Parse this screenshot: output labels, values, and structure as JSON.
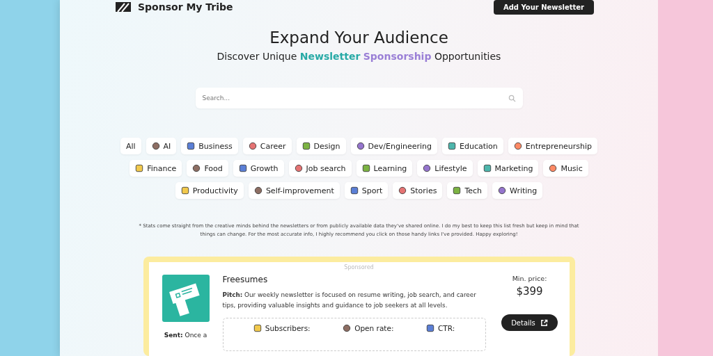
{
  "header": {
    "brand": "Sponsor My Tribe",
    "cta": "Add Your Newsletter"
  },
  "hero": {
    "title": "Expand Your Audience",
    "subtitle": "Discover Unique ",
    "highlight_1": "Newsletter",
    "highlight_2": "Sponsorship",
    "subtitle_end": " Opportunities"
  },
  "search": {
    "placeholder": "Search..."
  },
  "categories": [
    {
      "label": "All",
      "icon": false
    },
    {
      "label": "AI",
      "icon": true
    },
    {
      "label": "Business",
      "icon": true
    },
    {
      "label": "Career",
      "icon": true
    },
    {
      "label": "Design",
      "icon": true
    },
    {
      "label": "Dev/Engineering",
      "icon": true
    },
    {
      "label": "Education",
      "icon": true
    },
    {
      "label": "Entrepreneurship",
      "icon": true
    },
    {
      "label": "Finance",
      "icon": true
    },
    {
      "label": "Food",
      "icon": true
    },
    {
      "label": "Growth",
      "icon": true
    },
    {
      "label": "Job search",
      "icon": true
    },
    {
      "label": "Learning",
      "icon": true
    },
    {
      "label": "Lifestyle",
      "icon": true
    },
    {
      "label": "Marketing",
      "icon": true
    },
    {
      "label": "Music",
      "icon": true
    },
    {
      "label": "Productivity",
      "icon": true
    },
    {
      "label": "Self-improvement",
      "icon": true
    },
    {
      "label": "Sport",
      "icon": true
    },
    {
      "label": "Stories",
      "icon": true
    },
    {
      "label": "Tech",
      "icon": true
    },
    {
      "label": "Writing",
      "icon": true
    }
  ],
  "disclaimer": "* Stats come straight from the creative minds behind the newsletters or from publicly available data they've shared online. I do my best to keep this list fresh but keep in mind that things can change. For the most accurate info, I highly recommend you click on those handy links I've provided. Happy exploring!",
  "listing": {
    "badge": "Sponsored",
    "name": "Freesumes",
    "pitch": "**Pitch:** Our weekly newsletter is focused on resume writing, job search, and career tips, providing valuable insights and guidance to job seekers at all levels.",
    "sent": "**Sent:** Once a",
    "price_label": "Min. price:",
    "price": "$399",
    "details": "Details",
    "stats": [
      "Subscribers:",
      "Open rate:",
      "CTR:"
    ]
  }
}
